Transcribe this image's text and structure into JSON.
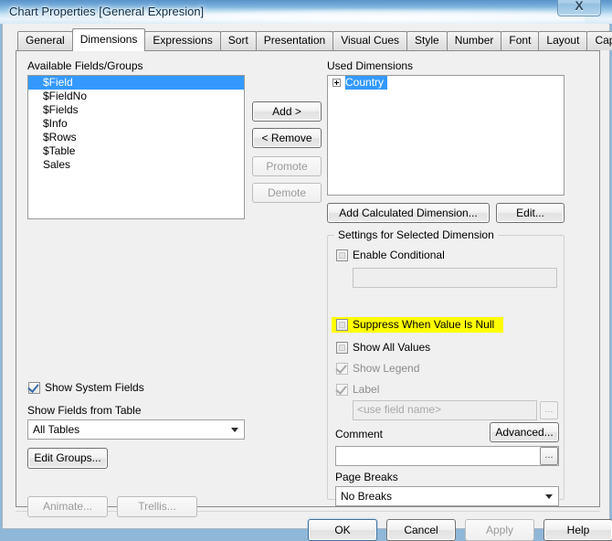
{
  "window": {
    "title": "Chart Properties [General Expresion]",
    "close_glyph": "X"
  },
  "tabs": [
    {
      "label": "General",
      "active": false
    },
    {
      "label": "Dimensions",
      "active": true
    },
    {
      "label": "Expressions",
      "active": false
    },
    {
      "label": "Sort",
      "active": false
    },
    {
      "label": "Presentation",
      "active": false
    },
    {
      "label": "Visual Cues",
      "active": false
    },
    {
      "label": "Style",
      "active": false
    },
    {
      "label": "Number",
      "active": false
    },
    {
      "label": "Font",
      "active": false
    },
    {
      "label": "Layout",
      "active": false
    },
    {
      "label": "Caption",
      "active": false
    }
  ],
  "left": {
    "available_label": "Available Fields/Groups",
    "fields": [
      {
        "name": "$Field",
        "selected": true
      },
      {
        "name": "$FieldNo",
        "selected": false
      },
      {
        "name": "$Fields",
        "selected": false
      },
      {
        "name": "$Info",
        "selected": false
      },
      {
        "name": "$Rows",
        "selected": false
      },
      {
        "name": "$Table",
        "selected": false
      },
      {
        "name": "Sales",
        "selected": false
      }
    ],
    "show_system_fields_label": "Show System Fields",
    "show_system_fields_checked": true,
    "show_fields_from_table_label": "Show Fields from Table",
    "table_filter_value": "All Tables",
    "edit_groups_label": "Edit Groups...",
    "animate_label": "Animate...",
    "trellis_label": "Trellis..."
  },
  "transfer": {
    "add_label": "Add >",
    "remove_label": "< Remove",
    "promote_label": "Promote",
    "demote_label": "Demote"
  },
  "right": {
    "used_dimensions_label": "Used Dimensions",
    "used_dimensions": [
      {
        "name": "Country",
        "selected": true,
        "expandable": true
      }
    ],
    "add_calculated_label": "Add Calculated Dimension...",
    "edit_label": "Edit...",
    "settings": {
      "group_title": "Settings for Selected Dimension",
      "enable_conditional_label": "Enable Conditional",
      "enable_conditional_checked": false,
      "conditional_value": "",
      "suppress_null_label": "Suppress When Value Is Null",
      "suppress_null_checked": false,
      "suppress_null_highlighted": true,
      "show_all_values_label": "Show All Values",
      "show_all_values_checked": false,
      "show_legend_label": "Show Legend",
      "show_legend_checked": true,
      "label_label": "Label",
      "label_checked": true,
      "label_placeholder": "<use field name>",
      "label_value": "",
      "label_browse_glyph": "...",
      "advanced_label": "Advanced...",
      "comment_label": "Comment",
      "comment_value": "",
      "comment_browse_glyph": "...",
      "page_breaks_label": "Page Breaks",
      "page_breaks_value": "No Breaks"
    }
  },
  "footer": {
    "ok_label": "OK",
    "cancel_label": "Cancel",
    "apply_label": "Apply",
    "help_label": "Help"
  },
  "colors": {
    "selection_blue": "#3399ff",
    "highlight_yellow": "#ffff00",
    "dialog_face": "#f0f0f0"
  }
}
